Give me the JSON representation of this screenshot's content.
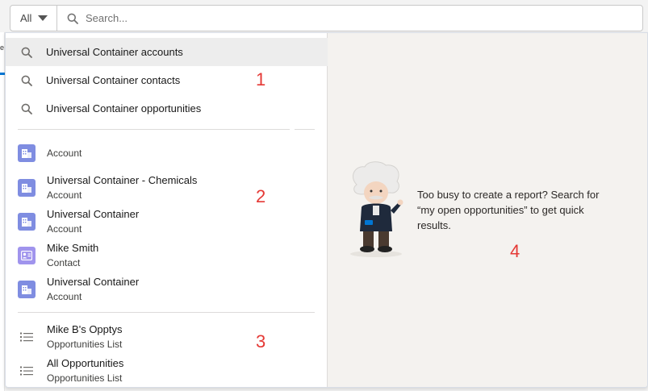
{
  "background": {
    "edge_text": "e"
  },
  "search": {
    "scope_label": "All",
    "placeholder": "Search..."
  },
  "suggestions": [
    {
      "label": "Universal Container accounts"
    },
    {
      "label": "Universal Container contacts"
    },
    {
      "label": "Universal Container opportunities"
    }
  ],
  "records": [
    {
      "title": "",
      "subtitle": "Account",
      "icon": "account-icon"
    },
    {
      "title": "Universal Container - Chemicals",
      "subtitle": "Account",
      "icon": "account-icon"
    },
    {
      "title": "Universal Container",
      "subtitle": "Account",
      "icon": "account-icon"
    },
    {
      "title": "Mike Smith",
      "subtitle": "Contact",
      "icon": "contact-icon"
    },
    {
      "title": "Universal Container",
      "subtitle": "Account",
      "icon": "account-icon"
    }
  ],
  "lists": [
    {
      "title": "Mike B's Opptys",
      "subtitle": "Opportunities List",
      "icon": "list-icon"
    },
    {
      "title": "All Opportunities",
      "subtitle": "Opportunities List",
      "icon": "list-icon"
    }
  ],
  "tip": {
    "text": "Too busy to create a report? Search for “my open opportunities” to get quick results."
  },
  "markers": {
    "m1": "1",
    "m2": "2",
    "m3": "3",
    "m4": "4"
  },
  "colors": {
    "account": "#7f8de1",
    "contact": "#a094ed",
    "annotation": "#e53935",
    "right_panel": "#f4f2ef"
  }
}
